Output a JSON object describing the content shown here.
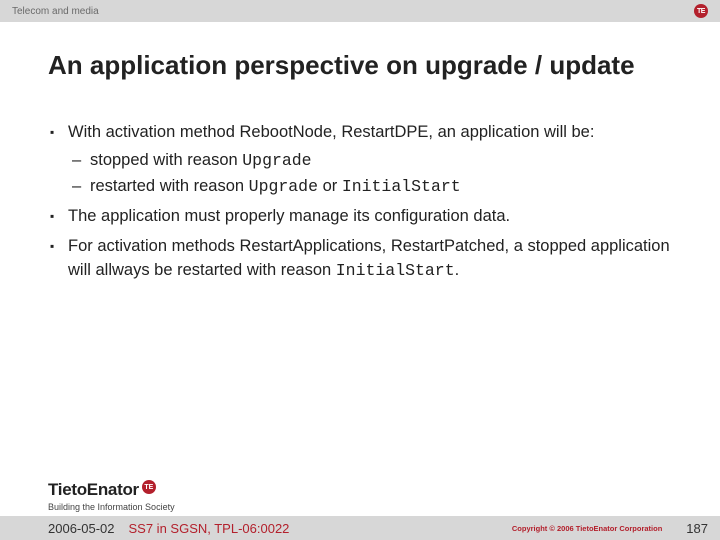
{
  "topbar": {
    "label": "Telecom and media",
    "badge": "TE"
  },
  "title": "An application perspective on upgrade / update",
  "bullets": [
    {
      "text_before": "With activation method RebootNode, RestartDPE, an application will be:",
      "sub": [
        {
          "pre": "stopped with reason ",
          "code1": "Upgrade",
          "post": ""
        },
        {
          "pre": "restarted with reason ",
          "code1": "Upgrade",
          "mid": " or ",
          "code2": "InitialStart",
          "post": ""
        }
      ]
    },
    {
      "text_before": "The application must properly manage its configuration data."
    },
    {
      "pre": "For activation methods RestartApplications, RestartPatched, a stopped application will allways be restarted with reason ",
      "code1": "InitialStart",
      "post": "."
    }
  ],
  "logo": {
    "name": "TietoEnator",
    "badge": "TE",
    "tagline": "Building the Information Society"
  },
  "footer": {
    "date": "2006-05-02",
    "ref": "SS7 in SGSN, TPL-06:0022",
    "copyright": "Copyright © 2006 TietoEnator Corporation",
    "page": "187"
  }
}
